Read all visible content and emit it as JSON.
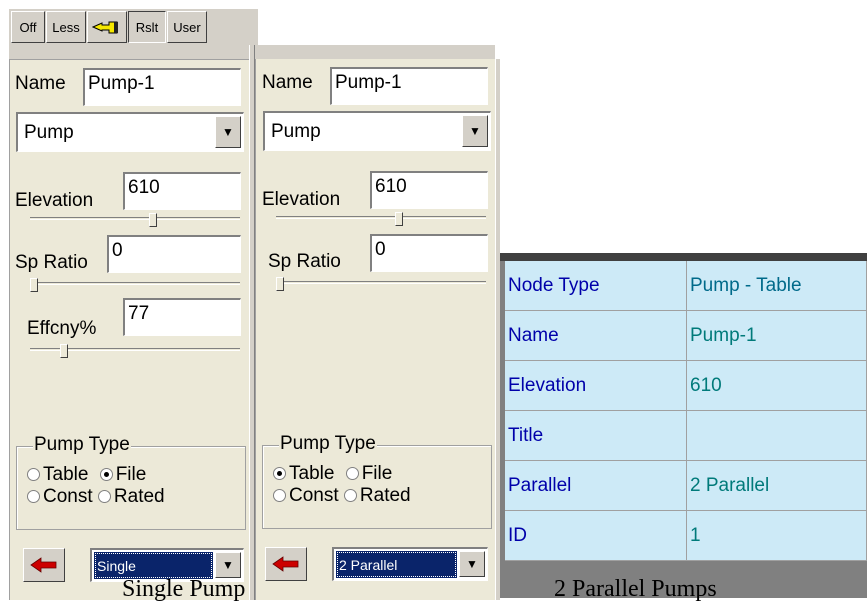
{
  "toolbar": {
    "buttons": [
      {
        "label": "Off"
      },
      {
        "label": "Less"
      },
      {
        "label": ""
      },
      {
        "label": "Rslt"
      },
      {
        "label": "User"
      }
    ]
  },
  "panel_left": {
    "name_label": "Name",
    "name_value": "Pump-1",
    "type_value": "Pump",
    "elevation_label": "Elevation",
    "elevation_value": "610",
    "elevation_level": 0.59,
    "spratio_label": "Sp Ratio",
    "spratio_value": "0",
    "spratio_level": 0.0,
    "effcny_label": "Effcny%",
    "effcny_value": "77",
    "effcny_level": 0.15,
    "pump_type_title": "Pump Type",
    "radios": {
      "table": "Table",
      "file": "File",
      "const": "Const",
      "rated": "Rated"
    },
    "selected_radio": "file",
    "mode_value": "Single"
  },
  "panel_right": {
    "name_label": "Name",
    "name_value": "Pump-1",
    "type_value": "Pump",
    "elevation_label": "Elevation",
    "elevation_value": "610",
    "elevation_level": 0.59,
    "spratio_label": "Sp Ratio",
    "spratio_value": "0",
    "spratio_level": 0.0,
    "pump_type_title": "Pump Type",
    "radios": {
      "table": "Table",
      "file": "File",
      "const": "Const",
      "rated": "Rated"
    },
    "selected_radio": "table",
    "mode_value": "2 Parallel"
  },
  "grid": {
    "rows": [
      {
        "key": "Node Type",
        "value": "Pump - Table"
      },
      {
        "key": "Name",
        "value": "Pump-1"
      },
      {
        "key": "Elevation",
        "value": "610"
      },
      {
        "key": "Title",
        "value": ""
      },
      {
        "key": "Parallel",
        "value": "2 Parallel"
      },
      {
        "key": "ID",
        "value": "1"
      }
    ]
  },
  "captions": {
    "left": "Single Pump",
    "right": "2 Parallel Pumps"
  },
  "colors": {
    "panel_bg": "#ece9d8",
    "grid_cell_bg": "#cdeaf7",
    "grid_key_text": "#0000aa",
    "grid_value_text": "#007a7a",
    "selection_bg": "#0a246a",
    "arrow_red": "#cc0000"
  },
  "icons": {
    "toolbar_hand": "pointing-hand-icon",
    "back": "red-left-arrow-icon",
    "dropdown": "chevron-down-icon"
  }
}
